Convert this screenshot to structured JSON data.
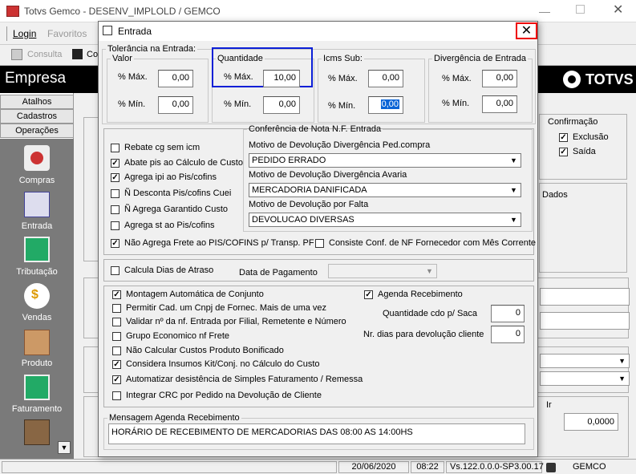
{
  "app": {
    "title": "Totvs Gemco - DESENV_IMPLOLD / GEMCO",
    "menu": {
      "login": "Login",
      "favoritos": "Favoritos"
    },
    "toolbar": {
      "consulta": "Consulta",
      "co": "Co"
    },
    "empresa": "Empresa",
    "brand": "TOTVS",
    "nav_tabs": [
      "Atalhos",
      "Cadastros",
      "Operações"
    ],
    "nav_items": [
      "Compras",
      "Entrada",
      "Tributação",
      "Vendas",
      "Produto",
      "Faturamento"
    ],
    "confirmacao": {
      "title": "Confirmação",
      "exclusao": "Exclusão",
      "saida": "Saída"
    },
    "dados": "Dados",
    "ir": "Ir",
    "bg_value": "0,0000",
    "status": {
      "date": "20/06/2020",
      "time": "08:22",
      "version": "Vs.122.0.0.0-SP3.00.17",
      "user": "GEMCO"
    }
  },
  "dialog": {
    "title": "Entrada",
    "tolerancia": {
      "title": "Tolerância na Entrada:",
      "valor": {
        "title": "Valor",
        "max_label": "% Máx.",
        "max": "0,00",
        "min_label": "% Mín.",
        "min": "0,00"
      },
      "quantidade": {
        "title": "Quantidade",
        "max_label": "% Máx.",
        "max": "10,00",
        "min_label": "% Mín.",
        "min": "0,00"
      },
      "icms": {
        "title": "Icms Sub:",
        "max_label": "% Máx.",
        "max": "0,00",
        "min_label": "% Mín.",
        "min": "0,00"
      },
      "divergencia": {
        "title": "Divergência de Entrada",
        "max_label": "% Máx.",
        "max": "0,00",
        "min_label": "% Mín.",
        "min": "0,00"
      }
    },
    "checks_left": [
      {
        "label": "Rebate cg sem icm",
        "checked": false
      },
      {
        "label": "Abate pis ao Cálculo de Custo",
        "checked": true
      },
      {
        "label": "Agrega ipi ao Pis/cofins",
        "checked": true
      },
      {
        "label": "Ñ Desconta Pis/cofins Cuei",
        "checked": false
      },
      {
        "label": "Ñ Agrega Garantido Custo",
        "checked": false
      },
      {
        "label": "Agrega st ao Pis/cofins",
        "checked": false
      }
    ],
    "conferencia": {
      "title": "Conferência de Nota N.F. Entrada",
      "mot1_label": "Motivo de Devolução Divergência Ped.compra",
      "mot1_value": "PEDIDO ERRADO",
      "mot2_label": "Motivo de Devolução Divergência Avaria",
      "mot2_value": "MERCADORIA DANIFICADA",
      "mot3_label": "Motivo de Devolução por Falta",
      "mot3_value": "DEVOLUCAO DIVERSAS"
    },
    "nao_agrega_frete": "Não Agrega Frete ao PIS/COFINS p/ Transp. PF",
    "consiste_conf": "Consiste Conf. de NF Fornecedor com Mês Corrente",
    "calcula_dias": "Calcula Dias de Atraso",
    "data_pagamento": "Data de Pagamento",
    "checks_bottom": [
      {
        "label": "Montagem Automática de Conjunto",
        "checked": true
      },
      {
        "label": "Permitir Cad. um Cnpj de Fornec. Mais de uma vez",
        "checked": false
      },
      {
        "label": "Validar nº da nf. Entrada por Filial, Remetente e Número",
        "checked": false
      },
      {
        "label": "Grupo Economico nf Frete",
        "checked": false
      },
      {
        "label": "Não Calcular Custos Produto Bonificado",
        "checked": false
      },
      {
        "label": "Considera Insumos Kit/Conj. no Cálculo do Custo",
        "checked": true
      },
      {
        "label": "Automatizar desistência de Simples Faturamento / Remessa",
        "checked": true
      },
      {
        "label": "Integrar CRC por Pedido na Devolução de Cliente",
        "checked": false
      }
    ],
    "agenda_recebimento": "Agenda Recebimento",
    "qtd_cdo_label": "Quantidade cdo p/ Saca",
    "qtd_cdo": "0",
    "nr_dias_label": "Nr. dias para devolução cliente",
    "nr_dias": "0",
    "mensagem": {
      "title": "Mensagem Agenda Recebimento",
      "text": "HORÁRIO DE RECEBIMENTO DE MERCADORIAS DAS 08:00 AS 14:00HS"
    }
  }
}
